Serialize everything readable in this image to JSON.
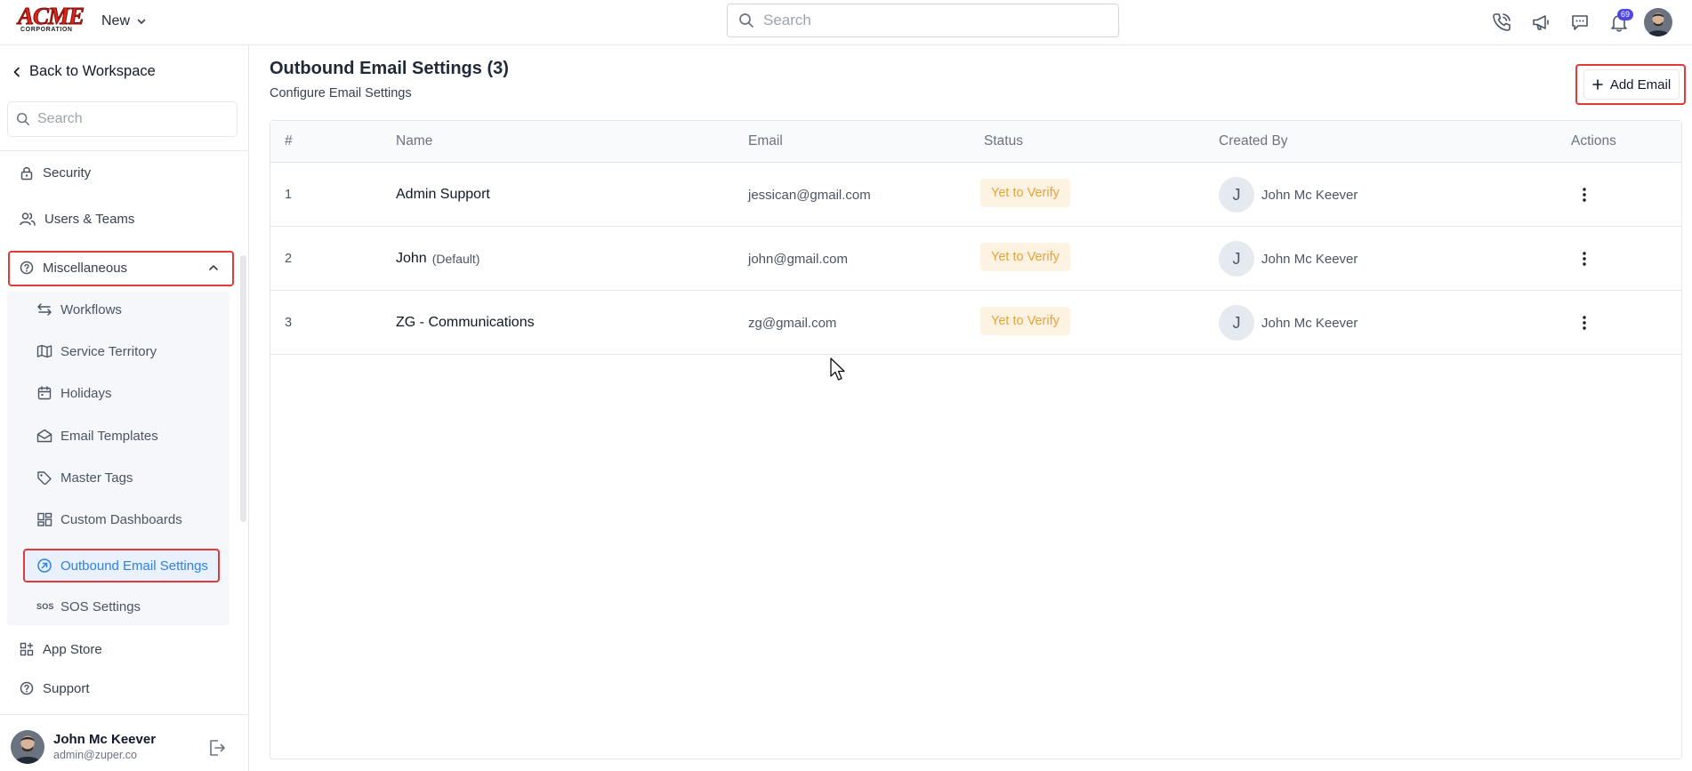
{
  "topbar": {
    "logo_text": "ACME",
    "logo_sub": "CORPORATION",
    "new_label": "New",
    "search_placeholder": "Search",
    "notification_count": "69"
  },
  "sidebar": {
    "back_label": "Back to Workspace",
    "search_placeholder": "Search",
    "items": [
      {
        "label": "Security",
        "icon": "lock-icon"
      },
      {
        "label": "Users & Teams",
        "icon": "users-icon"
      },
      {
        "label": "Miscellaneous",
        "icon": "help-circle-icon"
      }
    ],
    "sub_items": [
      {
        "label": "Workflows",
        "icon": "arrows-swap-icon"
      },
      {
        "label": "Service Territory",
        "icon": "map-icon"
      },
      {
        "label": "Holidays",
        "icon": "calendar-icon"
      },
      {
        "label": "Email Templates",
        "icon": "mail-open-icon"
      },
      {
        "label": "Master Tags",
        "icon": "tag-icon"
      },
      {
        "label": "Custom Dashboards",
        "icon": "dashboard-icon"
      },
      {
        "label": "Outbound Email Settings",
        "icon": "outbound-icon"
      },
      {
        "label": "SOS Settings",
        "icon": "sos-icon"
      }
    ],
    "bottom_items": [
      {
        "label": "App Store",
        "icon": "apps-icon"
      },
      {
        "label": "Support",
        "icon": "help-circle-icon"
      }
    ],
    "user": {
      "name": "John Mc Keever",
      "email": "admin@zuper.co"
    }
  },
  "main": {
    "title": "Outbound Email Settings (3)",
    "subtitle": "Configure Email Settings",
    "add_button": "Add Email",
    "columns": [
      "#",
      "Name",
      "Email",
      "Status",
      "Created By",
      "Actions"
    ],
    "rows": [
      {
        "num": "1",
        "name": "Admin Support",
        "default_tag": "",
        "email": "jessican@gmail.com",
        "status": "Yet to Verify",
        "creator_initial": "J",
        "creator": "John Mc Keever"
      },
      {
        "num": "2",
        "name": "John",
        "default_tag": "(Default)",
        "email": "john@gmail.com",
        "status": "Yet to Verify",
        "creator_initial": "J",
        "creator": "John Mc Keever"
      },
      {
        "num": "3",
        "name": "ZG - Communications",
        "default_tag": "",
        "email": "zg@gmail.com",
        "status": "Yet to Verify",
        "creator_initial": "J",
        "creator": "John Mc Keever"
      }
    ]
  },
  "colors": {
    "accent": "#2f80ed",
    "highlight_border": "#e03a3a",
    "status_text": "#e8a23a",
    "status_bg": "#fef3e2",
    "badge": "#4f46e5"
  }
}
